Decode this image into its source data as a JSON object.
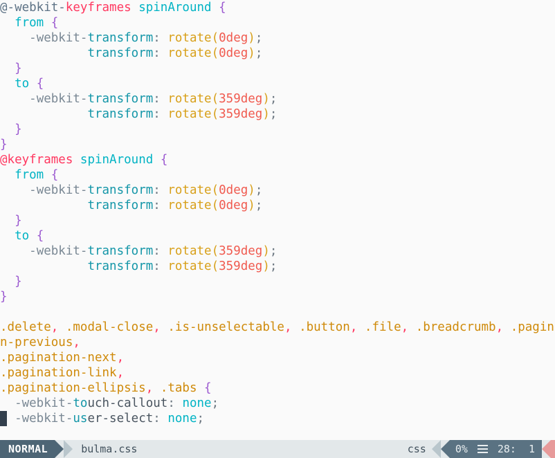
{
  "app": {
    "kind": "terminal-text-editor",
    "filetype": "css",
    "background": "#fafafa"
  },
  "colors": {
    "at_keyword": "#ff3860",
    "identifier": "#00b3c4",
    "property": "#1496a8",
    "function": "#d8a01a",
    "number": "#f05a4f",
    "brace": "#9b59d0",
    "selector": "#cf8a0a",
    "statusline_mode_bg": "#4d6575",
    "statusline_right_bg": "#5a7282",
    "statusline_accent": "#e79a9a",
    "cursor": "#33404d"
  },
  "editor": {
    "lines": [
      {
        "tokens": [
          {
            "t": "@-webkit-",
            "c": "vendor"
          },
          {
            "t": "keyframes",
            "c": "atkw"
          },
          {
            "t": " ",
            "c": "dark"
          },
          {
            "t": "spinAround",
            "c": "ident"
          },
          {
            "t": " ",
            "c": "dark"
          },
          {
            "t": "{",
            "c": "brace"
          }
        ]
      },
      {
        "tokens": [
          {
            "t": "  ",
            "c": "dark"
          },
          {
            "t": "from",
            "c": "ident"
          },
          {
            "t": " ",
            "c": "dark"
          },
          {
            "t": "{",
            "c": "brace"
          }
        ]
      },
      {
        "tokens": [
          {
            "t": "    ",
            "c": "dark"
          },
          {
            "t": "-webkit-",
            "c": "propdim"
          },
          {
            "t": "transform",
            "c": "prop"
          },
          {
            "t": ": ",
            "c": "punct"
          },
          {
            "t": "rotate",
            "c": "func"
          },
          {
            "t": "(",
            "c": "func"
          },
          {
            "t": "0deg",
            "c": "number"
          },
          {
            "t": ")",
            "c": "func"
          },
          {
            "t": ";",
            "c": "punct"
          }
        ]
      },
      {
        "tokens": [
          {
            "t": "            ",
            "c": "dark"
          },
          {
            "t": "transform",
            "c": "prop"
          },
          {
            "t": ": ",
            "c": "punct"
          },
          {
            "t": "rotate",
            "c": "func"
          },
          {
            "t": "(",
            "c": "func"
          },
          {
            "t": "0deg",
            "c": "number"
          },
          {
            "t": ")",
            "c": "func"
          },
          {
            "t": ";",
            "c": "punct"
          }
        ]
      },
      {
        "tokens": [
          {
            "t": "  ",
            "c": "dark"
          },
          {
            "t": "}",
            "c": "brace"
          }
        ]
      },
      {
        "tokens": [
          {
            "t": "  ",
            "c": "dark"
          },
          {
            "t": "to",
            "c": "ident"
          },
          {
            "t": " ",
            "c": "dark"
          },
          {
            "t": "{",
            "c": "brace"
          }
        ]
      },
      {
        "tokens": [
          {
            "t": "    ",
            "c": "dark"
          },
          {
            "t": "-webkit-",
            "c": "propdim"
          },
          {
            "t": "transform",
            "c": "prop"
          },
          {
            "t": ": ",
            "c": "punct"
          },
          {
            "t": "rotate",
            "c": "func"
          },
          {
            "t": "(",
            "c": "func"
          },
          {
            "t": "359deg",
            "c": "number"
          },
          {
            "t": ")",
            "c": "func"
          },
          {
            "t": ";",
            "c": "punct"
          }
        ]
      },
      {
        "tokens": [
          {
            "t": "            ",
            "c": "dark"
          },
          {
            "t": "transform",
            "c": "prop"
          },
          {
            "t": ": ",
            "c": "punct"
          },
          {
            "t": "rotate",
            "c": "func"
          },
          {
            "t": "(",
            "c": "func"
          },
          {
            "t": "359deg",
            "c": "number"
          },
          {
            "t": ")",
            "c": "func"
          },
          {
            "t": ";",
            "c": "punct"
          }
        ]
      },
      {
        "tokens": [
          {
            "t": "  ",
            "c": "dark"
          },
          {
            "t": "}",
            "c": "brace"
          }
        ]
      },
      {
        "tokens": [
          {
            "t": "}",
            "c": "brace"
          }
        ]
      },
      {
        "tokens": [
          {
            "t": "@keyframes",
            "c": "atkw"
          },
          {
            "t": " ",
            "c": "dark"
          },
          {
            "t": "spinAround",
            "c": "ident"
          },
          {
            "t": " ",
            "c": "dark"
          },
          {
            "t": "{",
            "c": "brace"
          }
        ]
      },
      {
        "tokens": [
          {
            "t": "  ",
            "c": "dark"
          },
          {
            "t": "from",
            "c": "ident"
          },
          {
            "t": " ",
            "c": "dark"
          },
          {
            "t": "{",
            "c": "brace"
          }
        ]
      },
      {
        "tokens": [
          {
            "t": "    ",
            "c": "dark"
          },
          {
            "t": "-webkit-",
            "c": "propdim"
          },
          {
            "t": "transform",
            "c": "prop"
          },
          {
            "t": ": ",
            "c": "punct"
          },
          {
            "t": "rotate",
            "c": "func"
          },
          {
            "t": "(",
            "c": "func"
          },
          {
            "t": "0deg",
            "c": "number"
          },
          {
            "t": ")",
            "c": "func"
          },
          {
            "t": ";",
            "c": "punct"
          }
        ]
      },
      {
        "tokens": [
          {
            "t": "            ",
            "c": "dark"
          },
          {
            "t": "transform",
            "c": "prop"
          },
          {
            "t": ": ",
            "c": "punct"
          },
          {
            "t": "rotate",
            "c": "func"
          },
          {
            "t": "(",
            "c": "func"
          },
          {
            "t": "0deg",
            "c": "number"
          },
          {
            "t": ")",
            "c": "func"
          },
          {
            "t": ";",
            "c": "punct"
          }
        ]
      },
      {
        "tokens": [
          {
            "t": "  ",
            "c": "dark"
          },
          {
            "t": "}",
            "c": "brace"
          }
        ]
      },
      {
        "tokens": [
          {
            "t": "  ",
            "c": "dark"
          },
          {
            "t": "to",
            "c": "ident"
          },
          {
            "t": " ",
            "c": "dark"
          },
          {
            "t": "{",
            "c": "brace"
          }
        ]
      },
      {
        "tokens": [
          {
            "t": "    ",
            "c": "dark"
          },
          {
            "t": "-webkit-",
            "c": "propdim"
          },
          {
            "t": "transform",
            "c": "prop"
          },
          {
            "t": ": ",
            "c": "punct"
          },
          {
            "t": "rotate",
            "c": "func"
          },
          {
            "t": "(",
            "c": "func"
          },
          {
            "t": "359deg",
            "c": "number"
          },
          {
            "t": ")",
            "c": "func"
          },
          {
            "t": ";",
            "c": "punct"
          }
        ]
      },
      {
        "tokens": [
          {
            "t": "            ",
            "c": "dark"
          },
          {
            "t": "transform",
            "c": "prop"
          },
          {
            "t": ": ",
            "c": "punct"
          },
          {
            "t": "rotate",
            "c": "func"
          },
          {
            "t": "(",
            "c": "func"
          },
          {
            "t": "359deg",
            "c": "number"
          },
          {
            "t": ")",
            "c": "func"
          },
          {
            "t": ";",
            "c": "punct"
          }
        ]
      },
      {
        "tokens": [
          {
            "t": "  ",
            "c": "dark"
          },
          {
            "t": "}",
            "c": "brace"
          }
        ]
      },
      {
        "tokens": [
          {
            "t": "}",
            "c": "brace"
          }
        ]
      },
      {
        "tokens": []
      },
      {
        "tokens": [
          {
            "t": ".delete",
            "c": "sel"
          },
          {
            "t": ",",
            "c": "comma"
          },
          {
            "t": " ",
            "c": "dark"
          },
          {
            "t": ".modal-close",
            "c": "sel"
          },
          {
            "t": ",",
            "c": "comma"
          },
          {
            "t": " ",
            "c": "dark"
          },
          {
            "t": ".is-unselectable",
            "c": "sel"
          },
          {
            "t": ",",
            "c": "comma"
          },
          {
            "t": " ",
            "c": "dark"
          },
          {
            "t": ".button",
            "c": "sel"
          },
          {
            "t": ",",
            "c": "comma"
          },
          {
            "t": " ",
            "c": "dark"
          },
          {
            "t": ".file",
            "c": "sel"
          },
          {
            "t": ",",
            "c": "comma"
          },
          {
            "t": " ",
            "c": "dark"
          },
          {
            "t": ".breadcrumb",
            "c": "sel"
          },
          {
            "t": ",",
            "c": "comma"
          },
          {
            "t": " ",
            "c": "dark"
          },
          {
            "t": ".paginatio",
            "c": "sel"
          }
        ]
      },
      {
        "tokens": [
          {
            "t": "n-previous",
            "c": "sel"
          },
          {
            "t": ",",
            "c": "comma"
          }
        ]
      },
      {
        "tokens": [
          {
            "t": ".pagination-next",
            "c": "sel"
          },
          {
            "t": ",",
            "c": "comma"
          }
        ]
      },
      {
        "tokens": [
          {
            "t": ".pagination-link",
            "c": "sel"
          },
          {
            "t": ",",
            "c": "comma"
          }
        ]
      },
      {
        "tokens": [
          {
            "t": ".pagination-ellipsis",
            "c": "sel"
          },
          {
            "t": ",",
            "c": "comma"
          },
          {
            "t": " ",
            "c": "dark"
          },
          {
            "t": ".tabs",
            "c": "sel"
          },
          {
            "t": " ",
            "c": "dark"
          },
          {
            "t": "{",
            "c": "brace"
          }
        ]
      },
      {
        "tokens": [
          {
            "t": "  ",
            "c": "dark"
          },
          {
            "t": "-webkit-",
            "c": "propdim"
          },
          {
            "t": "to",
            "c": "prop"
          },
          {
            "t": "uch-callout",
            "c": "dark"
          },
          {
            "t": ": ",
            "c": "punct"
          },
          {
            "t": "none",
            "c": "ident"
          },
          {
            "t": ";",
            "c": "punct"
          }
        ]
      },
      {
        "cursor": true,
        "tokens": [
          {
            "t": "  ",
            "c": "dark"
          },
          {
            "t": "-webkit-",
            "c": "propdim"
          },
          {
            "t": "us",
            "c": "prop"
          },
          {
            "t": "er-select",
            "c": "dark"
          },
          {
            "t": ": ",
            "c": "punct"
          },
          {
            "t": "none",
            "c": "ident"
          },
          {
            "t": ";",
            "c": "punct"
          }
        ]
      }
    ]
  },
  "statusline": {
    "mode": "NORMAL",
    "filename": "bulma.css",
    "filetype": "css",
    "scroll_percent": "0%",
    "line_number": "28:",
    "column_number": "1",
    "lines_icon": "lines-icon"
  }
}
